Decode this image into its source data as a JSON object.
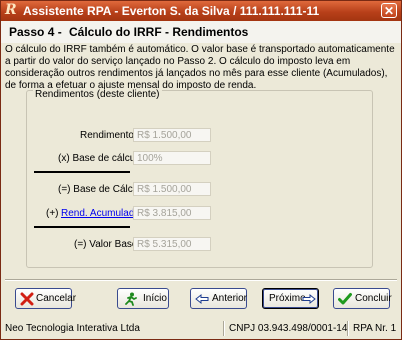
{
  "window": {
    "title": "Assistente RPA - Everton S. da Silva / 111.111.111-11",
    "logo_text": "R",
    "close_symbol": "✕"
  },
  "step": {
    "number": "Passo 4 -",
    "title": "Cálculo do IRRF - Rendimentos"
  },
  "description": "O cálculo do IRRF também é automático. O valor base é transportado automaticamente a partir do valor do serviço lançado no Passo 2. O cálculo do imposto leva em consideração outros rendimentos já lançados no mês para esse cliente (Acumulados), de forma a efetuar o ajuste mensal do imposto de renda.",
  "group": {
    "legend": "Rendimentos (deste cliente)",
    "rendimento": {
      "label": "Rendimento:",
      "value": "R$ 1.500,00"
    },
    "base_calculo_pct": {
      "label": "(x) Base de cálculo:",
      "value": "100%"
    },
    "base_calculo_val": {
      "label": "(=) Base de Cálculo:",
      "value": "R$ 1.500,00"
    },
    "acumulados": {
      "prefix": "(+)",
      "link": "Rend. Acumulados:",
      "value": "R$ 3.815,00"
    },
    "valor_base": {
      "label": "(=) Valor Base:",
      "value": "R$ 5.315,00"
    }
  },
  "buttons": {
    "cancelar": "Cancelar",
    "inicio": "Início",
    "anterior": "Anterior",
    "proximo": "Próximo",
    "concluir": "Concluir"
  },
  "status": {
    "company": "Neo Tecnologia Interativa Ltda",
    "cnpj": "CNPJ 03.943.498/0001-14",
    "rpa": "RPA Nr. 1"
  },
  "colors": {
    "title_bar": "#b8401a",
    "link": "#0000ee",
    "button_border": "#3a4b8f"
  }
}
